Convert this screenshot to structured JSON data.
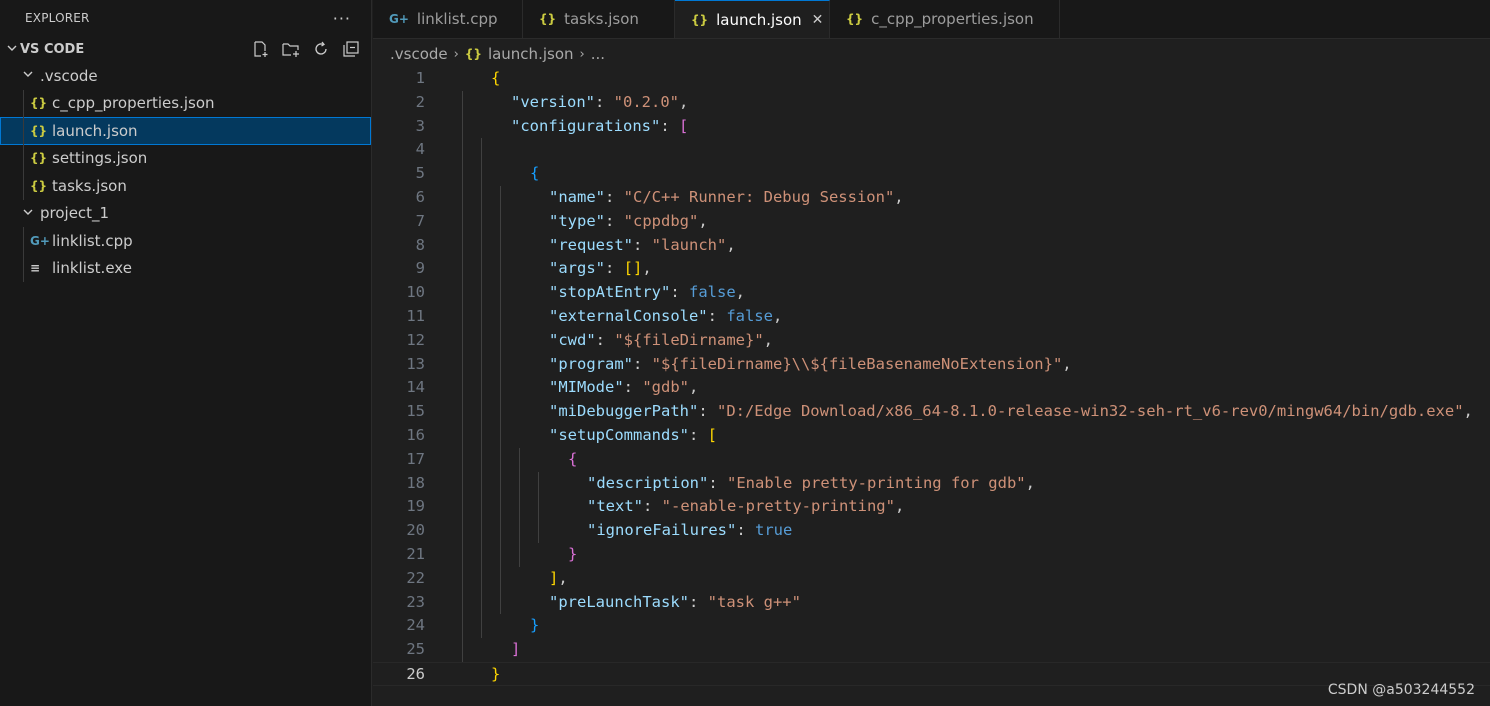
{
  "explorer": {
    "title": "EXPLORER",
    "more": "···",
    "workspace": "VS CODE",
    "tree": [
      {
        "label": ".vscode",
        "type": "folder"
      },
      {
        "label": "c_cpp_properties.json",
        "type": "json"
      },
      {
        "label": "launch.json",
        "type": "json",
        "selected": true
      },
      {
        "label": "settings.json",
        "type": "json"
      },
      {
        "label": "tasks.json",
        "type": "json"
      },
      {
        "label": "project_1",
        "type": "folder"
      },
      {
        "label": "linklist.cpp",
        "type": "cpp"
      },
      {
        "label": "linklist.exe",
        "type": "exe"
      }
    ]
  },
  "tabs": [
    {
      "label": "linklist.cpp",
      "icon": "cpp-icon"
    },
    {
      "label": "tasks.json",
      "icon": "json-icon"
    },
    {
      "label": "launch.json",
      "icon": "json-icon",
      "active": true
    },
    {
      "label": "c_cpp_properties.json",
      "icon": "json-icon"
    }
  ],
  "breadcrumb": {
    "folder": ".vscode",
    "file": "launch.json",
    "tail": "..."
  },
  "colors": {
    "accent": "#0078d4",
    "key": "#9cdcfe",
    "string": "#ce9178",
    "bool": "#569cd6",
    "json_icon": "#cbcb41",
    "cpp_icon": "#519aba"
  },
  "code": {
    "current_line": 26,
    "lines": [
      "1",
      "2",
      "3",
      "4",
      "5",
      "6",
      "7",
      "8",
      "9",
      "10",
      "11",
      "12",
      "13",
      "14",
      "15",
      "16",
      "17",
      "18",
      "19",
      "20",
      "21",
      "22",
      "23",
      "24",
      "25",
      "26"
    ],
    "tokens": {
      "l1": "{",
      "version_k": "\"version\"",
      "version_v": "\"0.2.0\"",
      "configurations_k": "\"configurations\"",
      "l5": "{",
      "name_k": "\"name\"",
      "name_v": "\"C/C++ Runner: Debug Session\"",
      "type_k": "\"type\"",
      "type_v": "\"cppdbg\"",
      "request_k": "\"request\"",
      "request_v": "\"launch\"",
      "args_k": "\"args\"",
      "stopAtEntry_k": "\"stopAtEntry\"",
      "stopAtEntry_v": "false",
      "externalConsole_k": "\"externalConsole\"",
      "externalConsole_v": "false",
      "cwd_k": "\"cwd\"",
      "cwd_v": "\"${fileDirname}\"",
      "program_k": "\"program\"",
      "program_v": "\"${fileDirname}\\\\${fileBasenameNoExtension}\"",
      "MIMode_k": "\"MIMode\"",
      "MIMode_v": "\"gdb\"",
      "miDebuggerPath_k": "\"miDebuggerPath\"",
      "miDebuggerPath_v": "\"D:/Edge Download/x86_64-8.1.0-release-win32-seh-rt_v6-rev0/mingw64/bin/gdb.exe\"",
      "setupCommands_k": "\"setupCommands\"",
      "description_k": "\"description\"",
      "description_v": "\"Enable pretty-printing for gdb\"",
      "text_k": "\"text\"",
      "text_v": "\"-enable-pretty-printing\"",
      "ignoreFailures_k": "\"ignoreFailures\"",
      "ignoreFailures_v": "true",
      "preLaunchTask_k": "\"preLaunchTask\"",
      "preLaunchTask_v": "\"task g++\""
    }
  },
  "watermark": "CSDN @a503244552"
}
